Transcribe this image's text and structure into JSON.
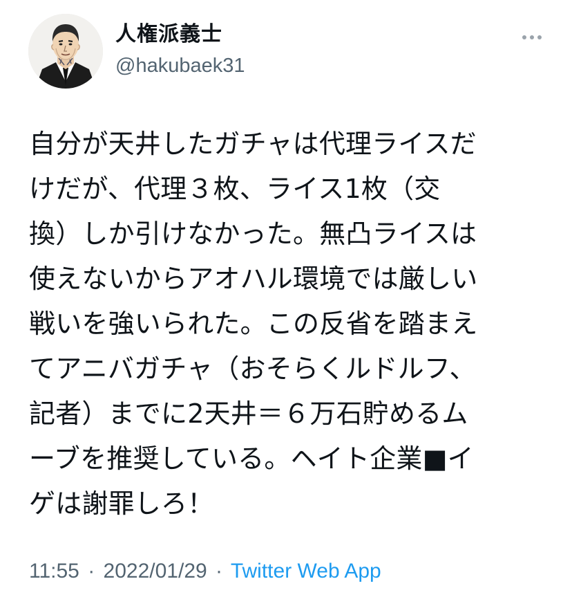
{
  "author": {
    "display_name": "人権派義士",
    "handle": "@hakubaek31"
  },
  "tweet": {
    "lines": [
      "自分が天井したガチャは代理ライスだ",
      "けだが、代理３枚、ライス1枚（交",
      "換）しか引けなかった。無凸ライスは",
      "使えないからアオハル環境では厳しい",
      "戦いを強いられた。この反省を踏まえ",
      "てアニバガチャ（おそらくルドルフ、",
      "記者）までに2天井＝６万石貯めるム",
      "ーブを推奨している。ヘイト企業■イ",
      "ゲは謝罪しろ！"
    ]
  },
  "meta": {
    "time": "11:55",
    "separator": "·",
    "date": "2022/01/29",
    "source": "Twitter Web App"
  },
  "icons": {
    "avatar": "avatar-illustration",
    "more": "more-options-icon"
  },
  "colors": {
    "text": "#0f1419",
    "secondary": "#536471",
    "link": "#1d9bf0",
    "background": "#ffffff"
  }
}
